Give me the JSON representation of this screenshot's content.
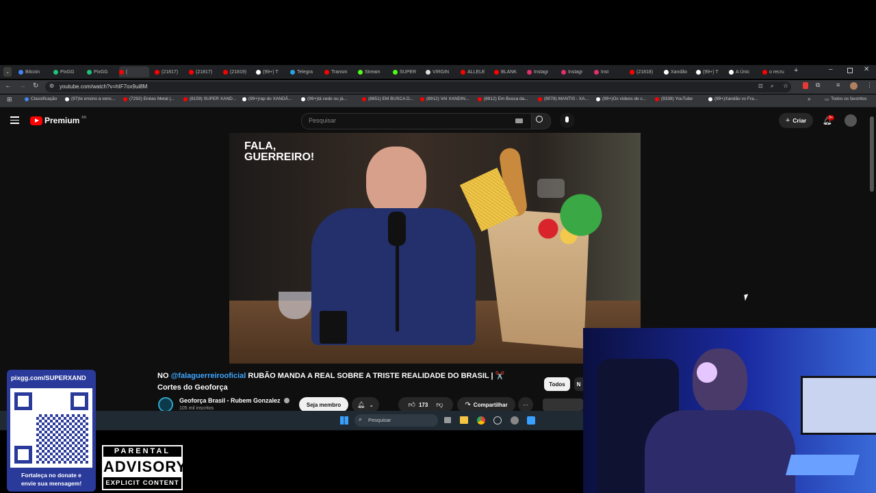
{
  "browser": {
    "tabs": [
      {
        "label": "Bitcoin",
        "color": "#4285f4"
      },
      {
        "label": "PixGG",
        "color": "#21c27a"
      },
      {
        "label": "PixGG",
        "color": "#21c27a"
      },
      {
        "label": "(",
        "color": "#ff0000"
      },
      {
        "label": "(21817)",
        "color": "#ff0000"
      },
      {
        "label": "(21817)",
        "color": "#ff0000"
      },
      {
        "label": "(21819)",
        "color": "#ff0000"
      },
      {
        "label": "(99+) T",
        "color": "#ffffff"
      },
      {
        "label": "Telegra",
        "color": "#2aa3df"
      },
      {
        "label": "Transm",
        "color": "#ff0000"
      },
      {
        "label": "Stream",
        "color": "#53fc18"
      },
      {
        "label": "SUPER",
        "color": "#53fc18"
      },
      {
        "label": "VIRGIN",
        "color": "#dddddd"
      },
      {
        "label": "ALLELE",
        "color": "#ff0000"
      },
      {
        "label": "BLANK",
        "color": "#ff0000"
      },
      {
        "label": "Instagr",
        "color": "#e1306c"
      },
      {
        "label": "Instagr",
        "color": "#e1306c"
      },
      {
        "label": "Inst",
        "color": "#e1306c"
      },
      {
        "label": "(21818)",
        "color": "#ff0000"
      },
      {
        "label": "Xandão",
        "color": "#ffffff"
      },
      {
        "label": "(99+) T",
        "color": "#ffffff"
      },
      {
        "label": "A Únic",
        "color": "#ffffff"
      },
      {
        "label": "o recru",
        "color": "#ff0000"
      }
    ],
    "url": "youtube.com/watch?v=hIF7ox9ui8M",
    "bookmarks": [
      {
        "label": "Classificação",
        "color": "#4285f4"
      },
      {
        "label": "(97)Ie ensino a venc...",
        "color": "#ffffff"
      },
      {
        "label": "(7292) Enéas Metal |...",
        "color": "#ff0000"
      },
      {
        "label": "(8159) SUPER XAND...",
        "color": "#ff0000"
      },
      {
        "label": "(99+)rap do XANDÃ...",
        "color": "#ffffff"
      },
      {
        "label": "(99+)tá cedo ou já...",
        "color": "#ffffff"
      },
      {
        "label": "(8851) EM BUSCA D...",
        "color": "#ff0000"
      },
      {
        "label": "(8912) VAI XANDIN...",
        "color": "#ff0000"
      },
      {
        "label": "(8912) Em Busca da...",
        "color": "#ff0000"
      },
      {
        "label": "(9078) MANTIS - XA...",
        "color": "#ff0000"
      },
      {
        "label": "(99+)Os vídeos de c...",
        "color": "#ffffff"
      },
      {
        "label": "(9338) YouTube",
        "color": "#ff0000"
      },
      {
        "label": "(99+)Xandão vs Fra...",
        "color": "#ffffff"
      }
    ],
    "bookmarks_more": "»",
    "all_favorites": "Todos os favoritos"
  },
  "youtube": {
    "logo": "Premium",
    "logo_region": "BR",
    "search_placeholder": "Pesquisar",
    "create_label": "Criar",
    "notif_count": "9+",
    "video_overlay_text": "FALA, GUERREIRO!",
    "title_prefix": "NO ",
    "title_mention": "@falaguerreirooficial",
    "title_rest": " RUBÃO MANDA A REAL SOBRE A TRISTE REALIDADE DO BRASIL | ✂️",
    "title_line2": "Cortes do Geoforça",
    "channel_name": "Geoforça Brasil - Rubem Gonzalez",
    "subscribers": "105 mil inscritos",
    "join_label": "Seja membro",
    "likes": "173",
    "share_label": "Compartilhar",
    "more_label": "···",
    "chip_all": "Todos",
    "chip_next": "N"
  },
  "taskbar": {
    "search_label": "Pesquisar"
  },
  "overlay": {
    "pix_url": "pixgg.com/SUPERXAND",
    "donate_line1": "Fortaleça no donate e",
    "donate_line2": "envie sua mensagem!",
    "advisory_top": "PARENTAL",
    "advisory_mid": "ADVISORY",
    "advisory_bottom": "EXPLICIT CONTENT"
  },
  "colors": {
    "yt_red": "#ff0000",
    "link_blue": "#3ea6ff",
    "bg": "#0f0f0f",
    "webcam_blue": "#1a2aa0"
  }
}
